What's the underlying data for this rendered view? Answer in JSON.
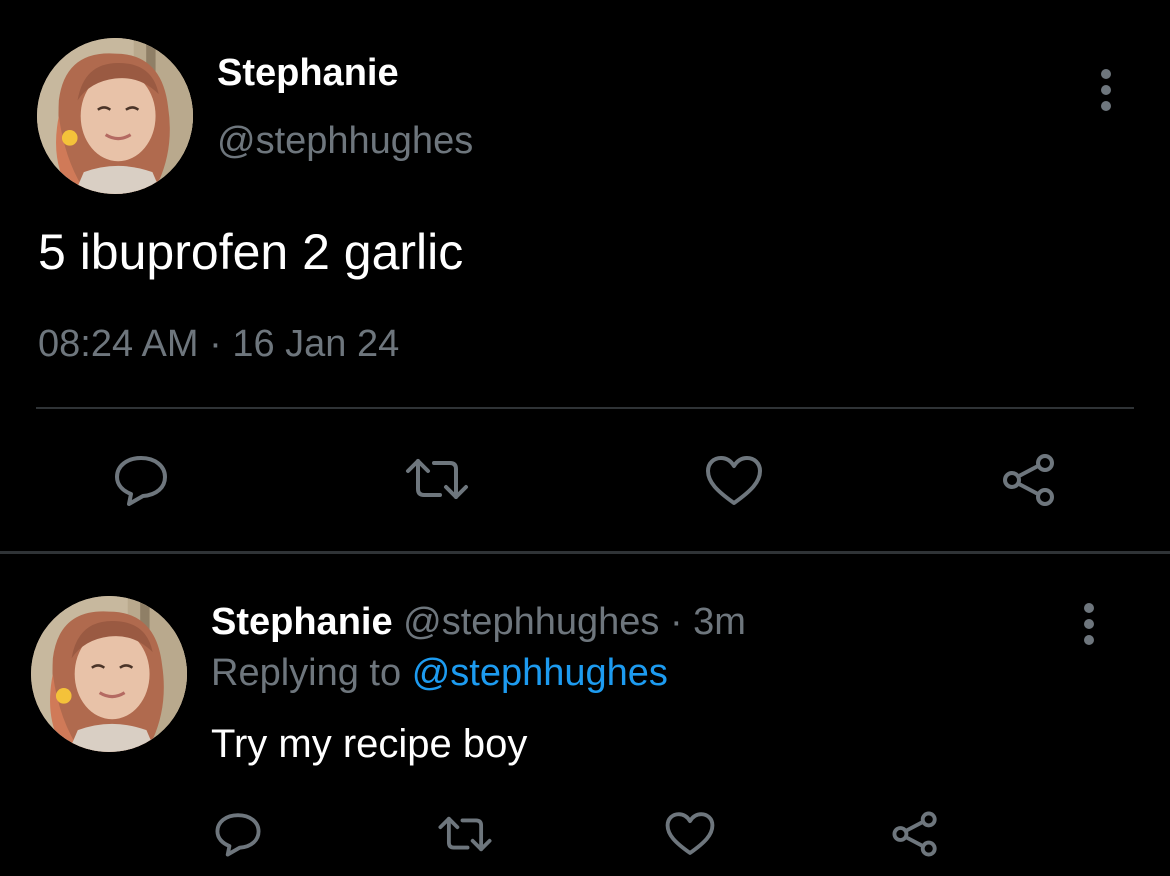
{
  "colors": {
    "background": "#000000",
    "primary_text": "#ffffff",
    "secondary_text": "#6e767d",
    "link": "#1d9bf0",
    "divider": "#2f3336",
    "icon": "#6e767d"
  },
  "main_tweet": {
    "author_name": "Stephanie",
    "author_handle": "@stephhughes",
    "text": "5 ibuprofen 2 garlic",
    "time": "08:24 AM",
    "separator": "·",
    "date": "16 Jan 24",
    "actions": [
      "reply-icon",
      "retweet-icon",
      "like-icon",
      "share-icon"
    ],
    "more_icon": "more-vertical-icon"
  },
  "reply": {
    "author_name": "Stephanie",
    "author_handle": "@stephhughes",
    "separator": "·",
    "time": "3m",
    "replying_to_label": "Replying to",
    "replying_to_handle": "@stephhughes",
    "text": "Try my recipe boy",
    "actions": [
      "reply-icon",
      "retweet-icon",
      "like-icon",
      "share-icon"
    ],
    "more_icon": "more-vertical-icon"
  }
}
